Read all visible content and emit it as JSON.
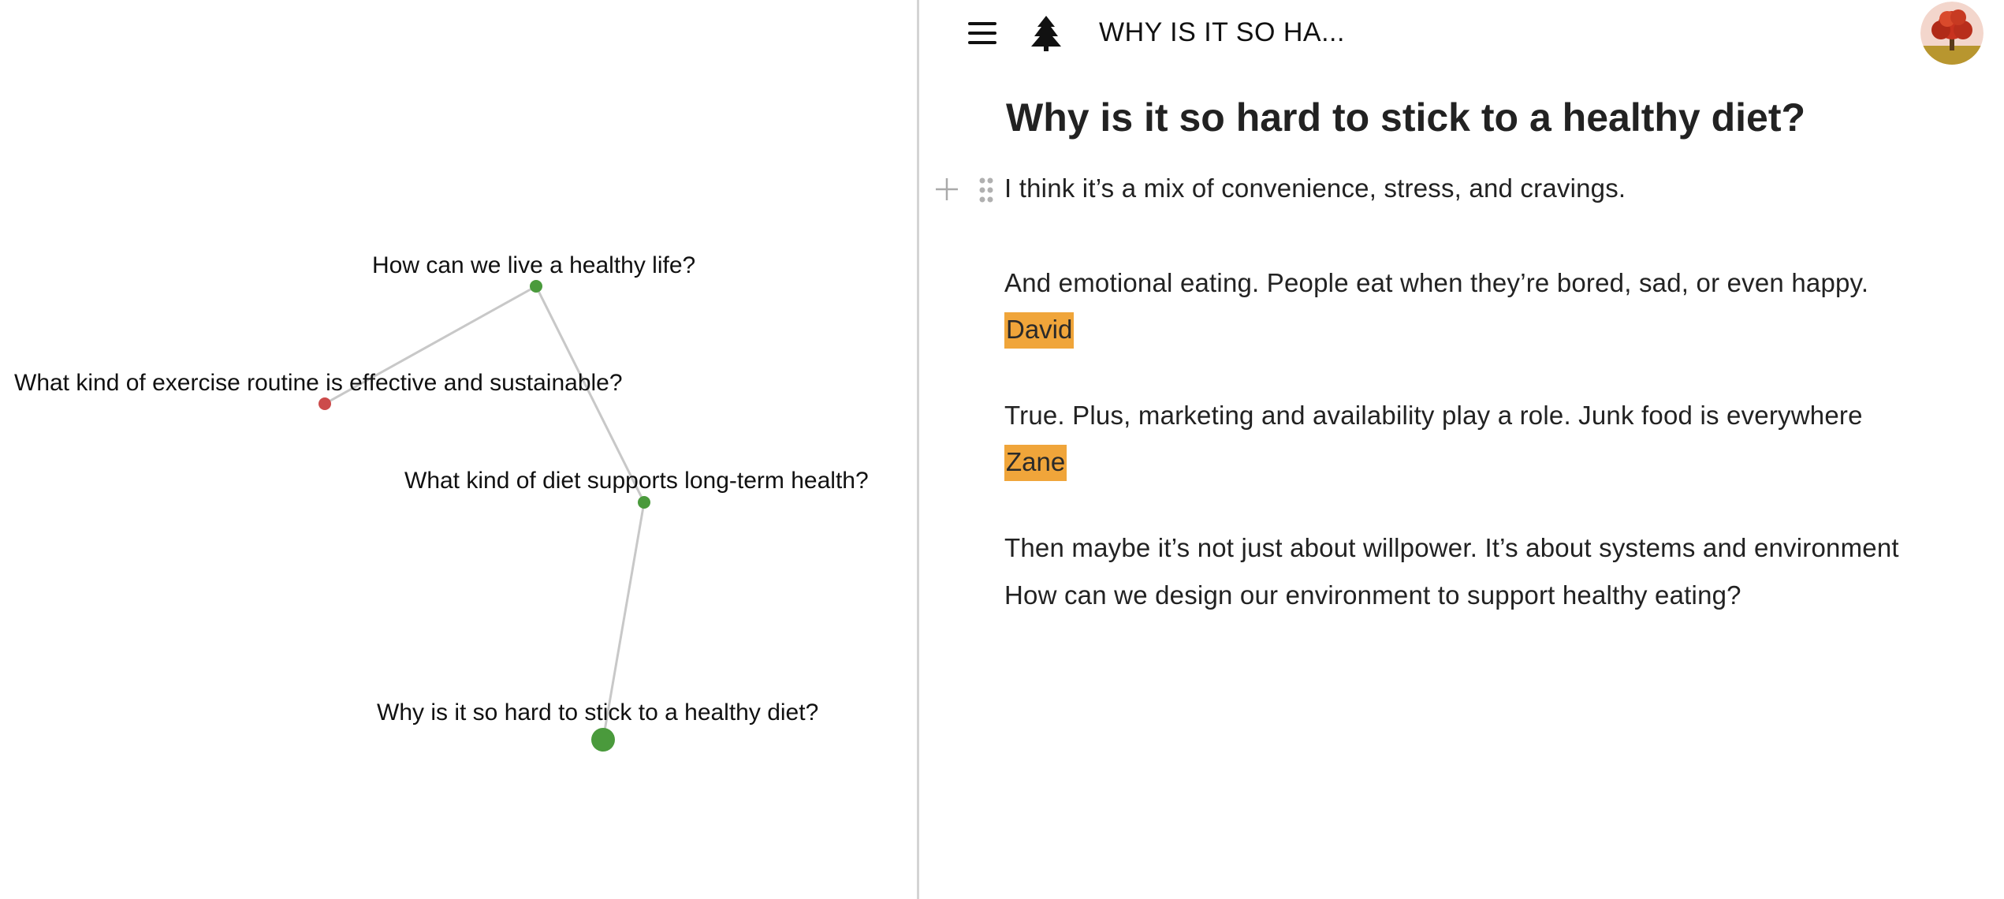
{
  "graph": {
    "nodes": [
      {
        "id": "n1",
        "label": "How can we live a healthy life?",
        "status": "green",
        "size": "small",
        "color": "#4a9a3c"
      },
      {
        "id": "n2",
        "label": "What kind of exercise routine is effective and sustainable?",
        "status": "red",
        "size": "small",
        "color": "#cc4b4b"
      },
      {
        "id": "n3",
        "label": "What kind of diet supports long-term health?",
        "status": "green",
        "size": "small",
        "color": "#4a9a3c"
      },
      {
        "id": "n4",
        "label": "Why is it so hard to stick to a healthy diet?",
        "status": "green",
        "size": "large",
        "color": "#4a9a3c"
      }
    ],
    "edges": [
      {
        "from": "n1",
        "to": "n2"
      },
      {
        "from": "n1",
        "to": "n3"
      },
      {
        "from": "n3",
        "to": "n4"
      }
    ],
    "edge_color": "#c8c8c8"
  },
  "topbar": {
    "menu_icon": "hamburger-menu-icon",
    "tree_icon": "pine-tree-icon",
    "breadcrumb": "WHY IS IT SO HA...",
    "avatar_icon": "tree-avatar"
  },
  "document": {
    "title": "Why is it so hard to stick to a healthy diet?",
    "blocks": [
      {
        "text": "I think it’s a mix of convenience, stress, and cravings."
      },
      {
        "text": "And emotional eating. People eat when they’re bored, sad, or even happy.",
        "author": "David"
      },
      {
        "text": "True. Plus, marketing and availability play a role. Junk food is everywhere",
        "author": "Zane"
      },
      {
        "text": "Then maybe it’s not just about willpower. It’s about systems and environment"
      },
      {
        "text": "How can we design our environment to support healthy eating?"
      }
    ],
    "author_tag_color": "#f0a53a"
  }
}
